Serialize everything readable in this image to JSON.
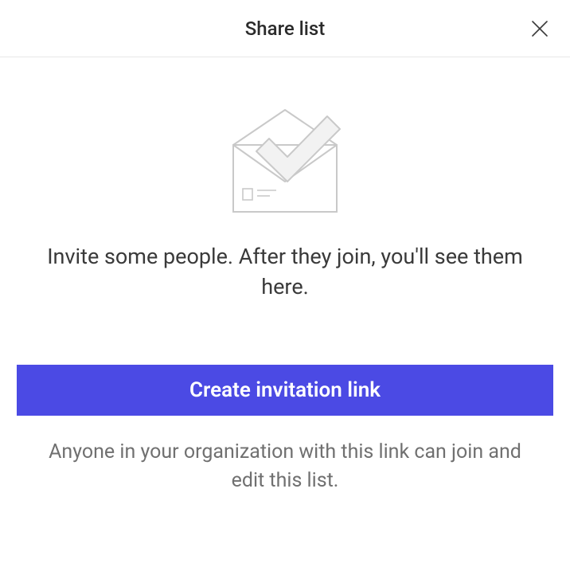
{
  "header": {
    "title": "Share list"
  },
  "body": {
    "invite_text": "Invite some people. After they join, you'll see them here.",
    "create_button_label": "Create invitation link",
    "footer_text": "Anyone in your organization with this link can join and edit this list."
  },
  "colors": {
    "primary": "#4b4ae4"
  }
}
